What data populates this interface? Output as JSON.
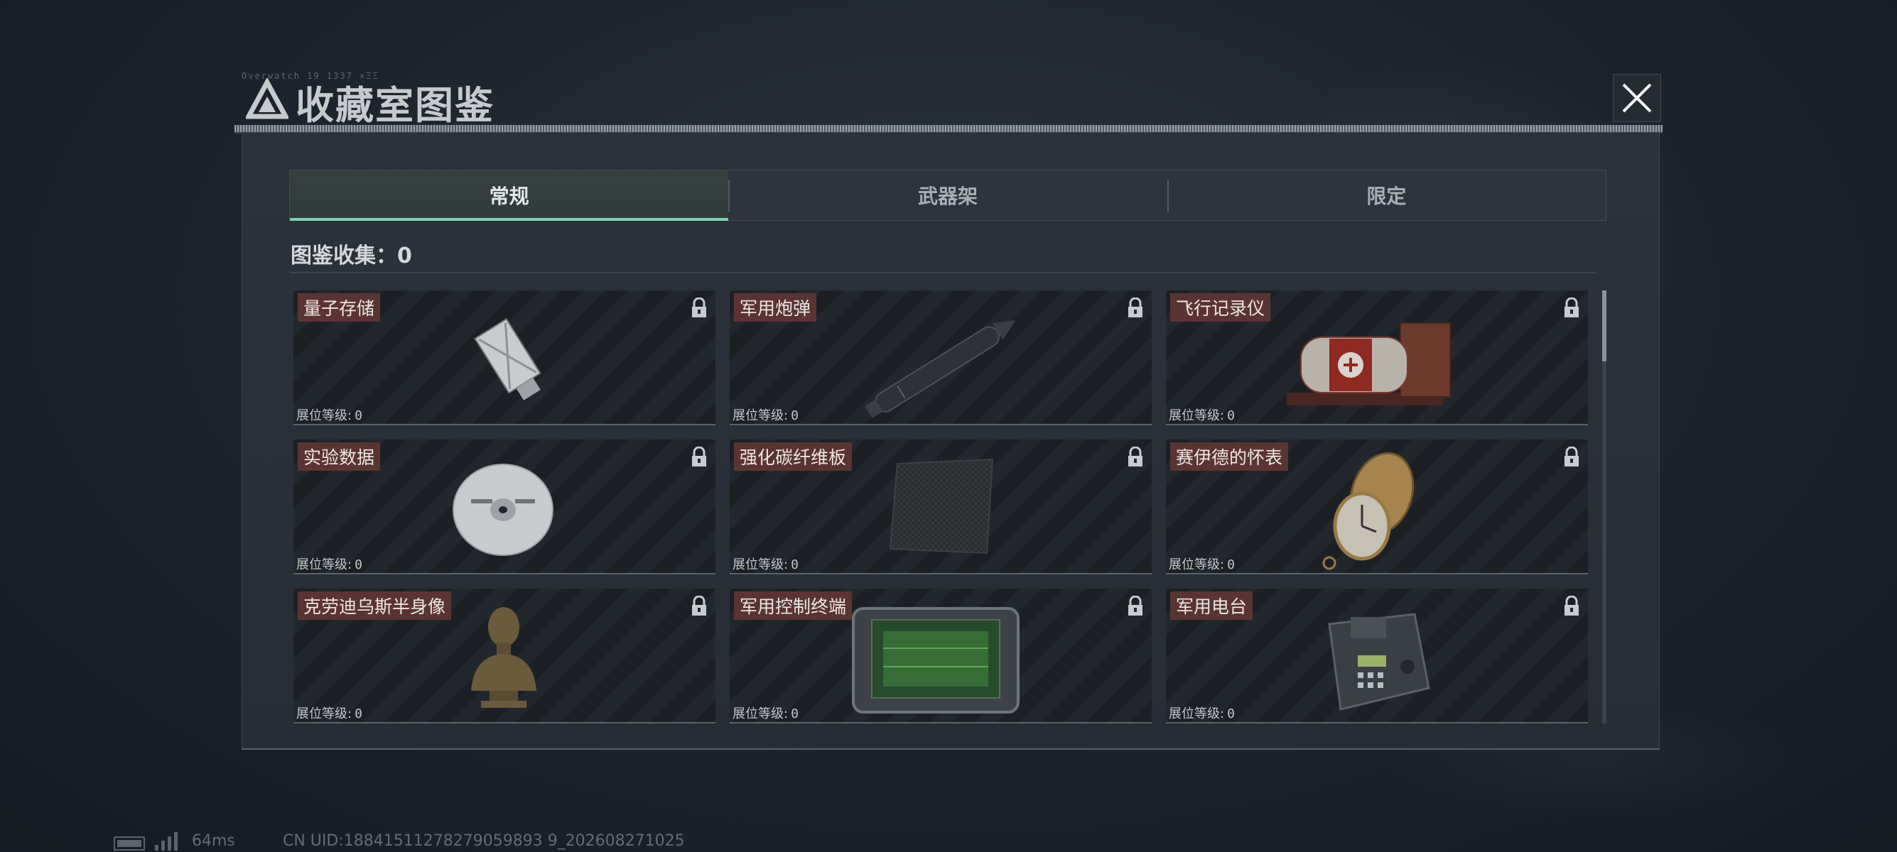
{
  "header": {
    "code": "Overwatch 19 1337 ×ΞΞ",
    "title": "收藏室图鉴"
  },
  "tabs": [
    {
      "label": "常规",
      "active": true
    },
    {
      "label": "武器架",
      "active": false
    },
    {
      "label": "限定",
      "active": false
    }
  ],
  "collection": {
    "label": "图鉴收集：",
    "count": "0"
  },
  "items": [
    {
      "name": "量子存储",
      "level_label": "展位等级:",
      "level": "0",
      "locked": true,
      "icon": "usb-drive-icon"
    },
    {
      "name": "军用炮弹",
      "level_label": "展位等级:",
      "level": "0",
      "locked": true,
      "icon": "artillery-shell-icon"
    },
    {
      "name": "飞行记录仪",
      "level_label": "展位等级:",
      "level": "0",
      "locked": true,
      "icon": "flight-recorder-icon"
    },
    {
      "name": "实验数据",
      "level_label": "展位等级:",
      "level": "0",
      "locked": true,
      "icon": "disc-icon"
    },
    {
      "name": "强化碳纤维板",
      "level_label": "展位等级:",
      "level": "0",
      "locked": true,
      "icon": "carbon-plate-icon"
    },
    {
      "name": "赛伊德的怀表",
      "level_label": "展位等级:",
      "level": "0",
      "locked": true,
      "icon": "pocket-watch-icon"
    },
    {
      "name": "克劳迪乌斯半身像",
      "level_label": "展位等级:",
      "level": "0",
      "locked": true,
      "icon": "bust-icon"
    },
    {
      "name": "军用控制终端",
      "level_label": "展位等级:",
      "level": "0",
      "locked": true,
      "icon": "control-terminal-icon"
    },
    {
      "name": "军用电台",
      "level_label": "展位等级:",
      "level": "0",
      "locked": true,
      "icon": "radio-icon"
    }
  ],
  "footer": {
    "ping": "64ms",
    "uid": "CN UID:18841511278279059893 9_202608271025"
  },
  "colors": {
    "accent": "#7fd2ad",
    "label_bg": "#5a3433"
  }
}
